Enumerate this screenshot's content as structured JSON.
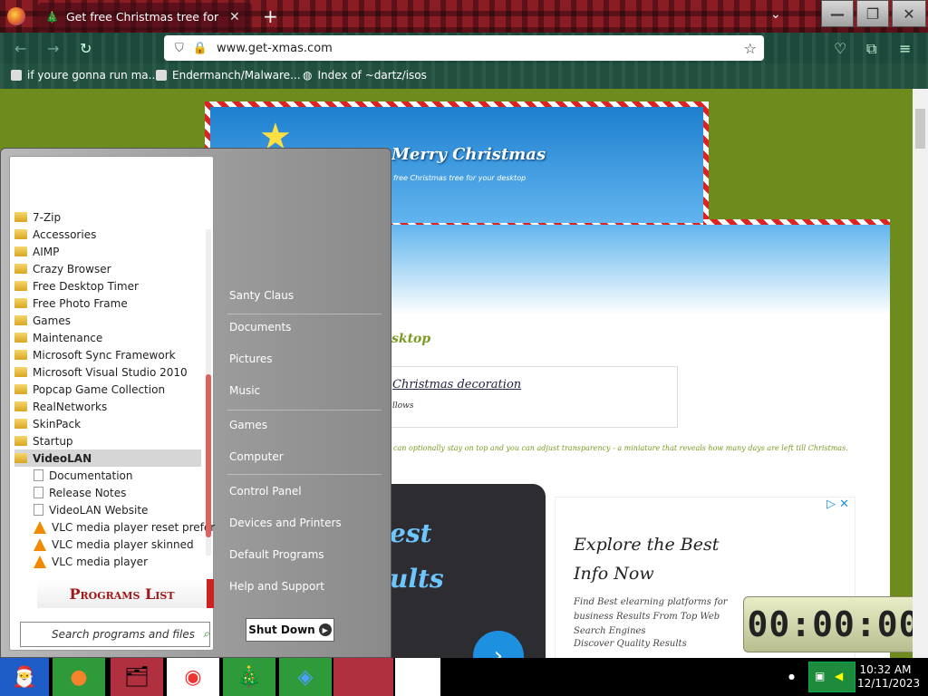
{
  "browser": {
    "tab_title": "Get free Christmas tree for your de",
    "tab_close": "✕",
    "new_tab": "+",
    "url": "www.get-xmas.com",
    "window_min": "—",
    "window_max": "❐",
    "window_close": "✕",
    "bookmarks": [
      {
        "label": "if youre gonna run ma..."
      },
      {
        "label": "Endermanch/Malware..."
      },
      {
        "label": "Index of ~dartz/isos"
      }
    ]
  },
  "page": {
    "banner_title": "Merry Christmas",
    "banner_subtitle": "free Christmas tree for your desktop",
    "tagline": "sktop",
    "feature_title": "Christmas decoration",
    "feature_sub": "llows",
    "body_line": "can optionally stay on top and you can adjust transparency - a miniature that reveals how many days are left till Christmas.",
    "promo_line1": "est",
    "promo_line2": "ults",
    "ad_heading": "Explore the Best Info Now",
    "ad_text": "Find Best elearning platforms for business Results From Top Web Search Engines",
    "ad_text2": "Discover Quality Results",
    "ad_close": "✕",
    "next_arrow": "›"
  },
  "timer": {
    "value": "00:00:00"
  },
  "start_menu": {
    "programs": [
      {
        "label": "7-Zip",
        "type": "folder"
      },
      {
        "label": "Accessories",
        "type": "folder"
      },
      {
        "label": "AIMP",
        "type": "folder"
      },
      {
        "label": "Crazy Browser",
        "type": "folder"
      },
      {
        "label": "Free Desktop Timer",
        "type": "folder"
      },
      {
        "label": "Free Photo Frame",
        "type": "folder"
      },
      {
        "label": "Games",
        "type": "folder"
      },
      {
        "label": "Maintenance",
        "type": "folder"
      },
      {
        "label": "Microsoft Sync Framework",
        "type": "folder"
      },
      {
        "label": "Microsoft Visual Studio 2010",
        "type": "folder"
      },
      {
        "label": "Popcap Game Collection",
        "type": "folder"
      },
      {
        "label": "RealNetworks",
        "type": "folder"
      },
      {
        "label": "SkinPack",
        "type": "folder"
      },
      {
        "label": "Startup",
        "type": "folder"
      },
      {
        "label": "VideoLAN",
        "type": "folder-selected"
      },
      {
        "label": "Documentation",
        "type": "doc"
      },
      {
        "label": "Release Notes",
        "type": "doc"
      },
      {
        "label": "VideoLAN Website",
        "type": "doc"
      },
      {
        "label": "VLC media player reset prefer",
        "type": "vlc"
      },
      {
        "label": "VLC media player skinned",
        "type": "vlc"
      },
      {
        "label": "VLC media player",
        "type": "vlc"
      }
    ],
    "programs_list_label": "Programs List",
    "search_placeholder": "Search programs and files",
    "right_items": [
      "Santy Claus",
      "Documents",
      "Pictures",
      "Music",
      "Games",
      "Computer",
      "Control Panel",
      "Devices and Printers",
      "Default Programs",
      "Help and Support"
    ],
    "shutdown_label": "Shut Down"
  },
  "taskbar": {
    "time": "10:32 AM",
    "date": "12/11/2023"
  }
}
